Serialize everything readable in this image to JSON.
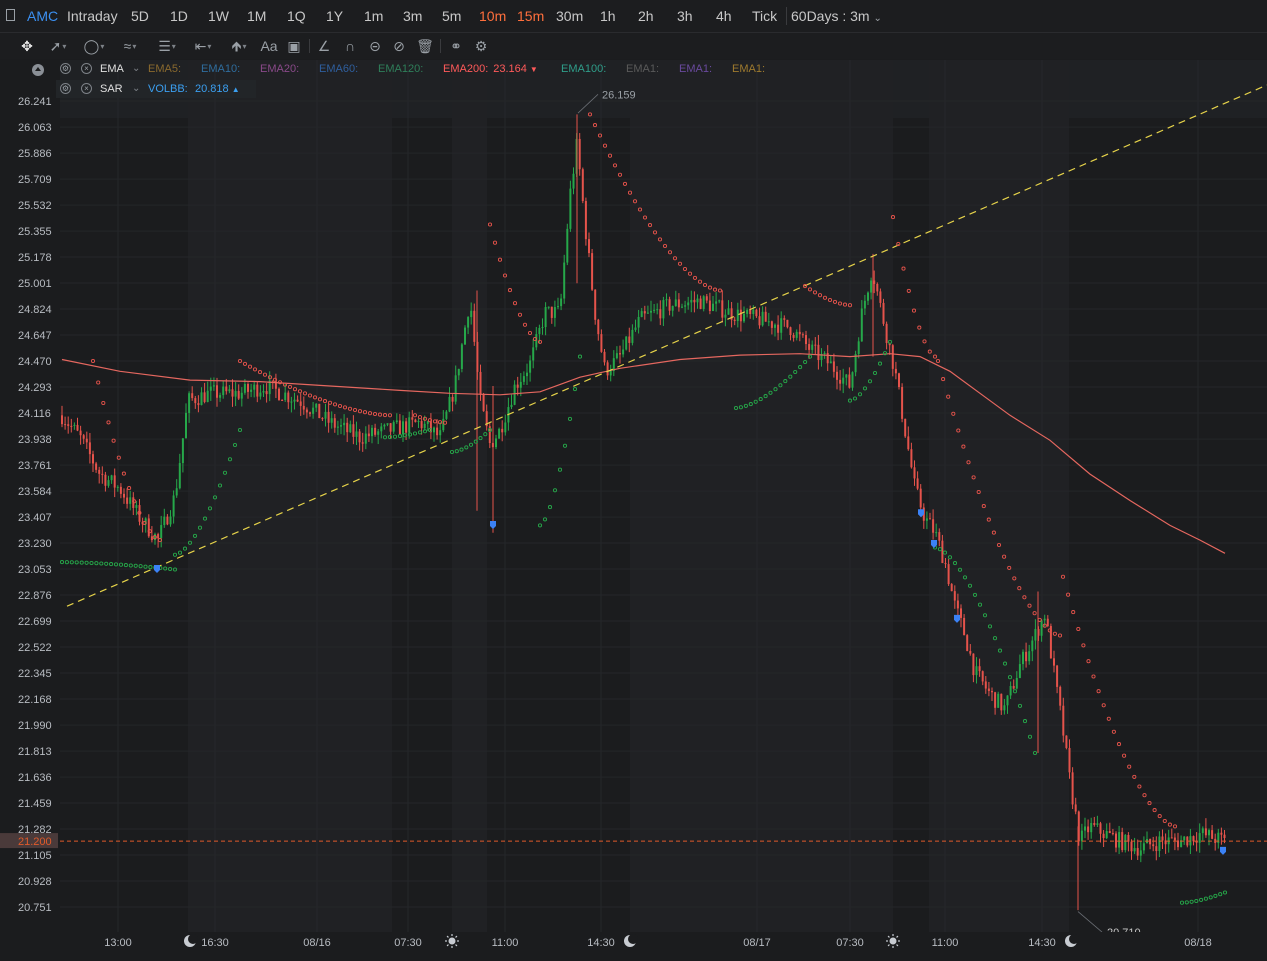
{
  "header": {
    "symbol": "AMC",
    "periods": [
      "Intraday",
      "5D",
      "1D",
      "1W",
      "1M",
      "1Q",
      "1Y",
      "1m",
      "3m",
      "5m",
      "10m",
      "15m",
      "30m",
      "1h",
      "2h",
      "3h",
      "4h",
      "Tick"
    ],
    "active_periods": [
      "10m",
      "15m"
    ],
    "range_selector": "60Days : 3m"
  },
  "toolbar": {
    "tools": [
      "move-crosshair-icon",
      "line-tool-icon",
      "shape-tool-icon",
      "multi-line-tool-icon",
      "text-list-icon",
      "measure-icon",
      "arrow-up-icon",
      "text-tool-icon",
      "comment-icon",
      "angle-icon",
      "magnet-icon",
      "lock-icon",
      "hide-icon",
      "delete-icon",
      "link-icon",
      "settings-icon"
    ],
    "text_tool_label": "Aa"
  },
  "indicators": {
    "main": {
      "name": "EMA",
      "items": [
        {
          "label": "EMA5:",
          "value": "",
          "color": "#8a6a2e"
        },
        {
          "label": "EMA10:",
          "value": "",
          "color": "#2f6d9e"
        },
        {
          "label": "EMA20:",
          "value": "",
          "color": "#8a4a8a"
        },
        {
          "label": "EMA60:",
          "value": "",
          "color": "#2f5f9e"
        },
        {
          "label": "EMA120:",
          "value": "",
          "color": "#2f7f5a"
        },
        {
          "label": "EMA200:",
          "value": "23.164",
          "color": "#ff5a5a"
        },
        {
          "label": "EMA100:",
          "value": "",
          "color": "#2f9e8a"
        },
        {
          "label": "EMA1:",
          "value": "",
          "color": "#5a5a5a"
        },
        {
          "label": "EMA1:",
          "value": "",
          "color": "#6a4a9e"
        },
        {
          "label": "EMA1:",
          "value": "",
          "color": "#9e7a2e"
        }
      ]
    },
    "sub": {
      "name": "SAR",
      "label": "VOLBB:",
      "value": "20.818",
      "color": "#3b9ff0"
    }
  },
  "price_axis": {
    "ticks": [
      "26.241",
      "26.063",
      "25.886",
      "25.709",
      "25.532",
      "25.355",
      "25.178",
      "25.001",
      "24.824",
      "24.647",
      "24.470",
      "24.293",
      "24.116",
      "23.938",
      "23.761",
      "23.584",
      "23.407",
      "23.230",
      "23.053",
      "22.876",
      "22.699",
      "22.522",
      "22.345",
      "22.168",
      "21.990",
      "21.813",
      "21.636",
      "21.459",
      "21.282",
      "21.105",
      "20.928",
      "20.751"
    ],
    "current_price": "21.200",
    "current_price_color": "#e05a2a"
  },
  "time_axis": {
    "labels": [
      "13:00",
      "16:30",
      "08/16",
      "07:30",
      "11:00",
      "14:30",
      "08/17",
      "07:30",
      "11:00",
      "14:30",
      "08/18"
    ],
    "session_icons": [
      "moon-icon",
      "sun-icon",
      "moon-icon",
      "sun-icon",
      "moon-icon"
    ]
  },
  "annotations": {
    "high_label": "26.159",
    "low_label": "20.710"
  },
  "chart_data": {
    "type": "candlestick",
    "symbol": "AMC",
    "interval": "3m",
    "ylim": [
      20.65,
      26.3
    ],
    "ema200_value": 23.164,
    "high": 26.159,
    "low": 20.71,
    "current": 21.2,
    "up_color": "#26a84a",
    "down_color": "#e5534b",
    "sar_up_color": "#26a84a",
    "sar_down_color": "#e5534b",
    "trendline_color": "#e6d34a",
    "ema200_color": "#e5675f"
  }
}
